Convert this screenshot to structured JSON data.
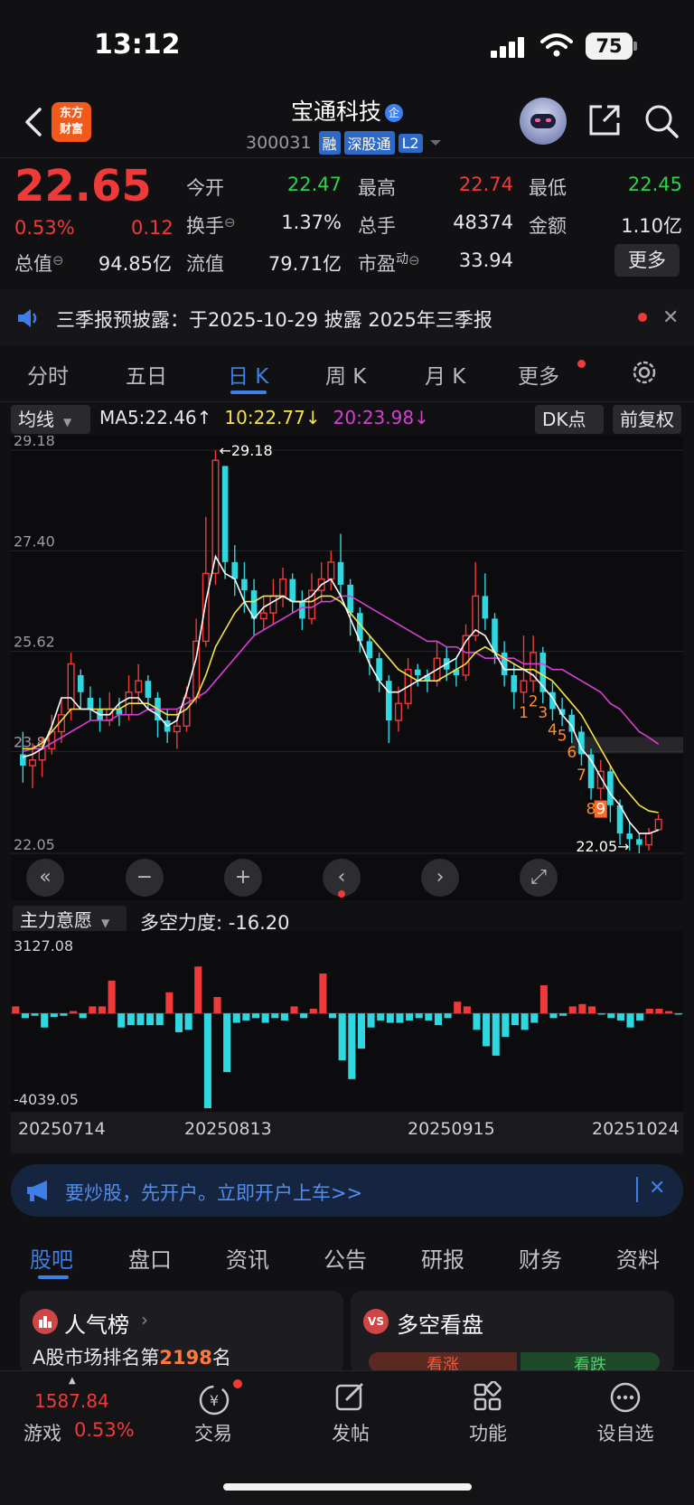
{
  "status_bar": {
    "time": "13:12",
    "battery": "75"
  },
  "header": {
    "logo_line1": "东方",
    "logo_line2": "财富",
    "title": "宝通科技",
    "title_badge": "企",
    "code": "300031",
    "tags": [
      "融",
      "深股通",
      "L2"
    ]
  },
  "quote": {
    "price": "22.65",
    "change_pct": "0.53%",
    "change": "0.12",
    "rows": [
      [
        {
          "label": "今开",
          "value": "22.47",
          "color": "green"
        },
        {
          "label": "最高",
          "value": "22.74",
          "color": "red"
        },
        {
          "label": "最低",
          "value": "22.45",
          "color": "green"
        }
      ],
      [
        {
          "label": "换手",
          "value": "1.37%",
          "color": "white"
        },
        {
          "label": "总手",
          "value": "48374",
          "color": "white"
        },
        {
          "label": "金额",
          "value": "1.10亿",
          "color": "white"
        }
      ]
    ],
    "market_cap_label": "总值",
    "market_cap": "94.85亿",
    "float_cap_label": "流值",
    "float_cap": "79.71亿",
    "pe_label": "市盈",
    "pe_sup": "动",
    "pe": "33.94",
    "more": "更多"
  },
  "notice": {
    "text": "三季报预披露：于2025-10-29 披露 2025年三季报"
  },
  "chart_tabs": [
    "分时",
    "五日",
    "日 K",
    "周 K",
    "月 K",
    "更多"
  ],
  "ma_row": {
    "selector": "均线",
    "ma5": "MA5:22.46",
    "ma5_arrow": "↑",
    "ma10": "10:22.77",
    "ma10_arrow": "↓",
    "ma20": "20:23.98",
    "ma20_arrow": "↓",
    "dk": "DK点",
    "adjust": "前复权",
    "ma_colors": {
      "ma5": "#ffffff",
      "ma10": "#f5e24a",
      "ma20": "#d63fd6"
    }
  },
  "chart_data": [
    {
      "type": "candlestick",
      "y_ticks": [
        "29.18",
        "27.40",
        "25.62",
        "23.85",
        "22.05"
      ],
      "ylim": [
        22.05,
        29.18
      ],
      "max_label": "29.18",
      "min_label": "22.05",
      "nine_turn_labels": [
        "1",
        "2",
        "3",
        "4",
        "5",
        "6",
        "7",
        "8",
        "9"
      ],
      "candles": [
        [
          23.8,
          23.6,
          24.2,
          23.3
        ],
        [
          23.6,
          23.7,
          24.0,
          23.2
        ],
        [
          23.7,
          23.9,
          24.1,
          23.4
        ],
        [
          23.9,
          24.2,
          24.5,
          23.8
        ],
        [
          24.2,
          24.5,
          24.8,
          24.0
        ],
        [
          24.6,
          25.4,
          25.6,
          24.4
        ],
        [
          25.2,
          24.9,
          25.3,
          24.6
        ],
        [
          24.8,
          24.6,
          25.0,
          24.4
        ],
        [
          24.6,
          24.4,
          24.8,
          24.2
        ],
        [
          24.4,
          24.6,
          24.9,
          24.3
        ],
        [
          24.6,
          24.5,
          24.8,
          24.3
        ],
        [
          24.5,
          24.9,
          25.2,
          24.4
        ],
        [
          24.9,
          25.1,
          25.4,
          24.7
        ],
        [
          25.1,
          24.8,
          25.2,
          24.6
        ],
        [
          24.8,
          24.4,
          24.9,
          24.1
        ],
        [
          24.4,
          24.2,
          24.6,
          24.0
        ],
        [
          24.2,
          24.3,
          24.6,
          23.9
        ],
        [
          24.3,
          24.8,
          25.0,
          24.2
        ],
        [
          24.8,
          25.8,
          26.2,
          24.7
        ],
        [
          25.8,
          27.0,
          28.0,
          25.7
        ],
        [
          27.0,
          29.0,
          29.18,
          26.8
        ],
        [
          28.9,
          27.2,
          28.9,
          26.9
        ],
        [
          27.2,
          26.9,
          27.5,
          26.6
        ],
        [
          26.9,
          26.7,
          27.2,
          26.3
        ],
        [
          26.7,
          26.2,
          26.9,
          25.9
        ],
        [
          26.2,
          26.3,
          26.6,
          26.0
        ],
        [
          26.3,
          26.6,
          26.9,
          26.1
        ],
        [
          26.6,
          26.9,
          27.1,
          26.4
        ],
        [
          26.9,
          26.5,
          27.0,
          26.3
        ],
        [
          26.5,
          26.2,
          26.7,
          26.0
        ],
        [
          26.2,
          26.7,
          27.0,
          26.1
        ],
        [
          26.7,
          26.9,
          27.2,
          26.5
        ],
        [
          26.9,
          27.2,
          27.4,
          26.7
        ],
        [
          27.2,
          26.8,
          27.7,
          26.6
        ],
        [
          26.8,
          26.3,
          26.9,
          25.9
        ],
        [
          26.3,
          25.8,
          26.4,
          25.6
        ],
        [
          25.8,
          25.5,
          25.9,
          25.2
        ],
        [
          25.5,
          25.1,
          25.6,
          24.9
        ],
        [
          25.1,
          24.4,
          25.2,
          24.0
        ],
        [
          24.4,
          24.7,
          25.0,
          24.2
        ],
        [
          24.7,
          25.3,
          25.5,
          24.6
        ],
        [
          25.3,
          25.2,
          25.4,
          25.0
        ],
        [
          25.2,
          25.1,
          25.3,
          24.9
        ],
        [
          25.1,
          25.5,
          25.8,
          25.0
        ],
        [
          25.5,
          25.3,
          25.7,
          25.1
        ],
        [
          25.3,
          25.2,
          25.5,
          25.0
        ],
        [
          25.2,
          25.9,
          26.1,
          25.1
        ],
        [
          25.9,
          26.6,
          27.2,
          25.8
        ],
        [
          26.6,
          26.2,
          27.0,
          26.0
        ],
        [
          26.2,
          25.6,
          26.3,
          25.4
        ],
        [
          25.6,
          25.2,
          25.8,
          25.0
        ],
        [
          25.2,
          24.9,
          25.4,
          24.6
        ],
        [
          24.9,
          25.1,
          25.9,
          24.7
        ],
        [
          25.1,
          25.6,
          25.9,
          24.9
        ],
        [
          25.6,
          24.9,
          25.7,
          24.7
        ],
        [
          24.9,
          24.6,
          25.1,
          24.4
        ],
        [
          24.6,
          24.5,
          24.8,
          24.3
        ],
        [
          24.5,
          24.2,
          24.6,
          24.0
        ],
        [
          24.2,
          23.8,
          24.3,
          23.6
        ],
        [
          23.8,
          23.2,
          23.9,
          23.0
        ],
        [
          23.2,
          23.5,
          23.7,
          23.0
        ],
        [
          23.5,
          22.9,
          23.6,
          22.6
        ],
        [
          22.9,
          22.4,
          23.0,
          22.2
        ],
        [
          22.4,
          22.3,
          22.6,
          22.1
        ],
        [
          22.3,
          22.2,
          22.4,
          22.05
        ],
        [
          22.2,
          22.4,
          22.5,
          22.1
        ],
        [
          22.47,
          22.65,
          22.74,
          22.45
        ]
      ],
      "ma5_line": [
        23.75,
        23.8,
        23.9,
        24.3,
        24.8,
        24.8,
        24.6,
        24.6,
        24.5,
        24.5,
        24.7,
        24.8,
        24.8,
        24.6,
        24.5,
        24.3,
        24.4,
        24.9,
        25.5,
        26.5,
        27.3,
        27.0,
        26.9,
        26.5,
        26.2,
        26.4,
        26.5,
        26.6,
        26.5,
        26.5,
        26.6,
        26.8,
        26.9,
        26.6,
        26.2,
        25.8,
        25.4,
        25.1,
        24.9,
        24.9,
        25.0,
        25.1,
        25.2,
        25.3,
        25.4,
        25.5,
        25.8,
        26.0,
        25.9,
        25.6,
        25.3,
        25.3,
        25.3,
        25.2,
        25.0,
        24.8,
        24.5,
        24.3,
        23.9,
        23.7,
        23.4,
        23.1,
        22.9,
        22.6,
        22.4,
        22.4,
        22.46
      ],
      "ma10_line": [
        23.9,
        23.9,
        24.0,
        24.2,
        24.4,
        24.6,
        24.6,
        24.6,
        24.6,
        24.6,
        24.6,
        24.7,
        24.7,
        24.7,
        24.6,
        24.5,
        24.5,
        24.6,
        24.8,
        25.2,
        25.7,
        26.0,
        26.3,
        26.5,
        26.5,
        26.6,
        26.6,
        26.6,
        26.5,
        26.5,
        26.5,
        26.6,
        26.6,
        26.5,
        26.3,
        26.1,
        25.9,
        25.7,
        25.5,
        25.3,
        25.2,
        25.1,
        25.1,
        25.1,
        25.2,
        25.3,
        25.4,
        25.6,
        25.7,
        25.6,
        25.5,
        25.4,
        25.3,
        25.3,
        25.2,
        25.1,
        24.9,
        24.7,
        24.5,
        24.2,
        23.9,
        23.6,
        23.3,
        23.1,
        22.9,
        22.8,
        22.77
      ],
      "ma20_line": [
        23.85,
        23.9,
        23.9,
        24.0,
        24.1,
        24.2,
        24.3,
        24.4,
        24.4,
        24.4,
        24.5,
        24.5,
        24.5,
        24.6,
        24.6,
        24.6,
        24.6,
        24.7,
        24.8,
        24.9,
        25.1,
        25.3,
        25.5,
        25.7,
        25.9,
        26.0,
        26.1,
        26.2,
        26.3,
        26.4,
        26.4,
        26.5,
        26.5,
        26.6,
        26.6,
        26.5,
        26.4,
        26.3,
        26.2,
        26.1,
        26.0,
        25.9,
        25.8,
        25.8,
        25.7,
        25.7,
        25.6,
        25.6,
        25.5,
        25.5,
        25.5,
        25.5,
        25.4,
        25.4,
        25.4,
        25.3,
        25.3,
        25.2,
        25.1,
        25.0,
        24.9,
        24.7,
        24.6,
        24.4,
        24.2,
        24.1,
        23.98
      ]
    },
    {
      "type": "bar",
      "name": "主力意愿",
      "indicator_label": "多空力度:",
      "indicator_value": "-16.20",
      "y_ticks": [
        "3127.08",
        "-4039.05"
      ],
      "ylim": [
        -4039.05,
        3127.08
      ],
      "x_ticks": [
        "20250714",
        "20250813",
        "20250915",
        "20251024"
      ],
      "values": [
        300,
        -200,
        -100,
        -600,
        -150,
        -100,
        100,
        -200,
        300,
        300,
        1400,
        -600,
        -500,
        -500,
        -500,
        -500,
        900,
        -800,
        -700,
        2000,
        -4039,
        700,
        -2500,
        -400,
        -300,
        -200,
        -400,
        -200,
        -300,
        300,
        -200,
        200,
        1700,
        -200,
        -2000,
        -2800,
        -1500,
        -600,
        -300,
        -400,
        -400,
        -300,
        -200,
        -300,
        -500,
        -200,
        500,
        300,
        -700,
        -1400,
        -1800,
        -1000,
        -500,
        -700,
        -400,
        1200,
        -200,
        -100,
        300,
        400,
        300,
        -50,
        -200,
        -300,
        -600,
        -300,
        200,
        200,
        100,
        -50
      ],
      "colors": {
        "positive": "#f03a3a",
        "negative": "#2fd8e0"
      }
    }
  ],
  "chart_controls": [
    "«",
    "−",
    "+",
    "‹",
    "›",
    "⤢"
  ],
  "promo": {
    "text": "要炒股，先开户。立即开户上车>>"
  },
  "bottom_tabs": [
    "股吧",
    "盘口",
    "资讯",
    "公告",
    "研报",
    "财务",
    "资料"
  ],
  "cards": {
    "rank_title": "人气榜",
    "rank_text_prefix": "A股市场排名第",
    "rank_number": "2198",
    "rank_text_suffix": "名",
    "vs_title": "多空看盘",
    "vs_up": "看涨",
    "vs_down": "看跌"
  },
  "bottom_nav": {
    "index_value": "1587.84",
    "index_label": "游戏",
    "index_pct": "0.53%",
    "items": [
      "交易",
      "发帖",
      "功能",
      "设自选"
    ]
  }
}
